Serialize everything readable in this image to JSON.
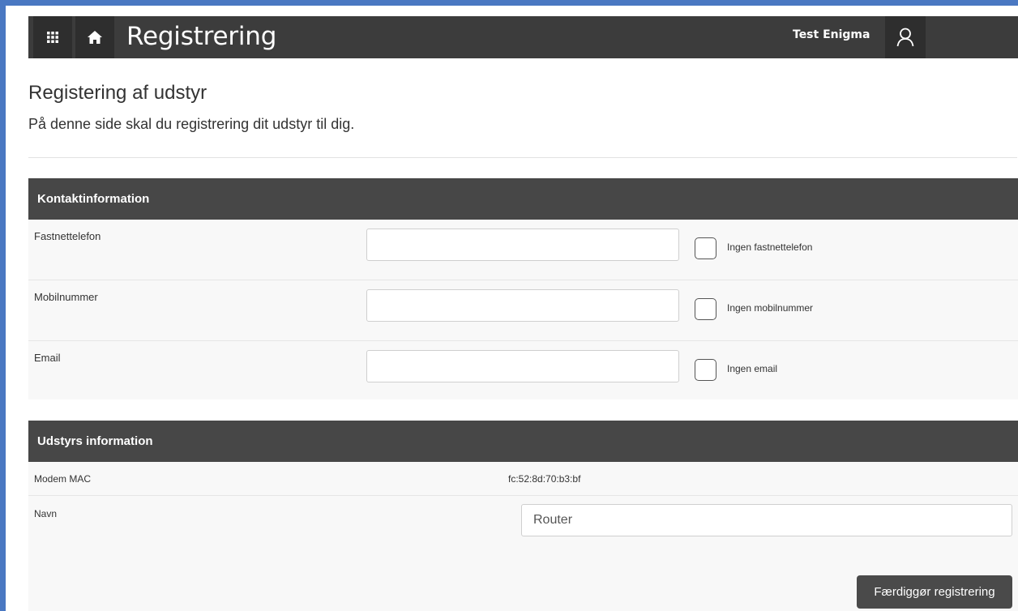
{
  "app": {
    "title": "Registrering",
    "user_name": "Test Enigma",
    "icons": {
      "apps": "apps-grid-icon",
      "home": "home-icon",
      "user": "user-icon"
    }
  },
  "page": {
    "heading": "Registering af udstyr",
    "subheading": "På denne side skal du registrering dit udstyr til dig."
  },
  "contact": {
    "header": "Kontaktinformation",
    "landline": {
      "label": "Fastnettelefon",
      "value": "",
      "none_label": "Ingen fastnettelefon",
      "none_checked": false
    },
    "mobile": {
      "label": "Mobilnummer",
      "value": "",
      "none_label": "Ingen mobilnummer",
      "none_checked": false
    },
    "email": {
      "label": "Email",
      "value": "",
      "none_label": "Ingen email",
      "none_checked": false
    }
  },
  "equipment": {
    "header": "Udstyrs information",
    "mac": {
      "label": "Modem MAC",
      "value": "fc:52:8d:70:b3:bf"
    },
    "name": {
      "label": "Navn",
      "value": "Router"
    }
  },
  "actions": {
    "finish_label": "Færdiggør registrering"
  },
  "colors": {
    "topbar": "#3c3c3c",
    "panel_header": "#474747",
    "frame_accent": "#4a78c2",
    "button": "#4a4a4a"
  }
}
